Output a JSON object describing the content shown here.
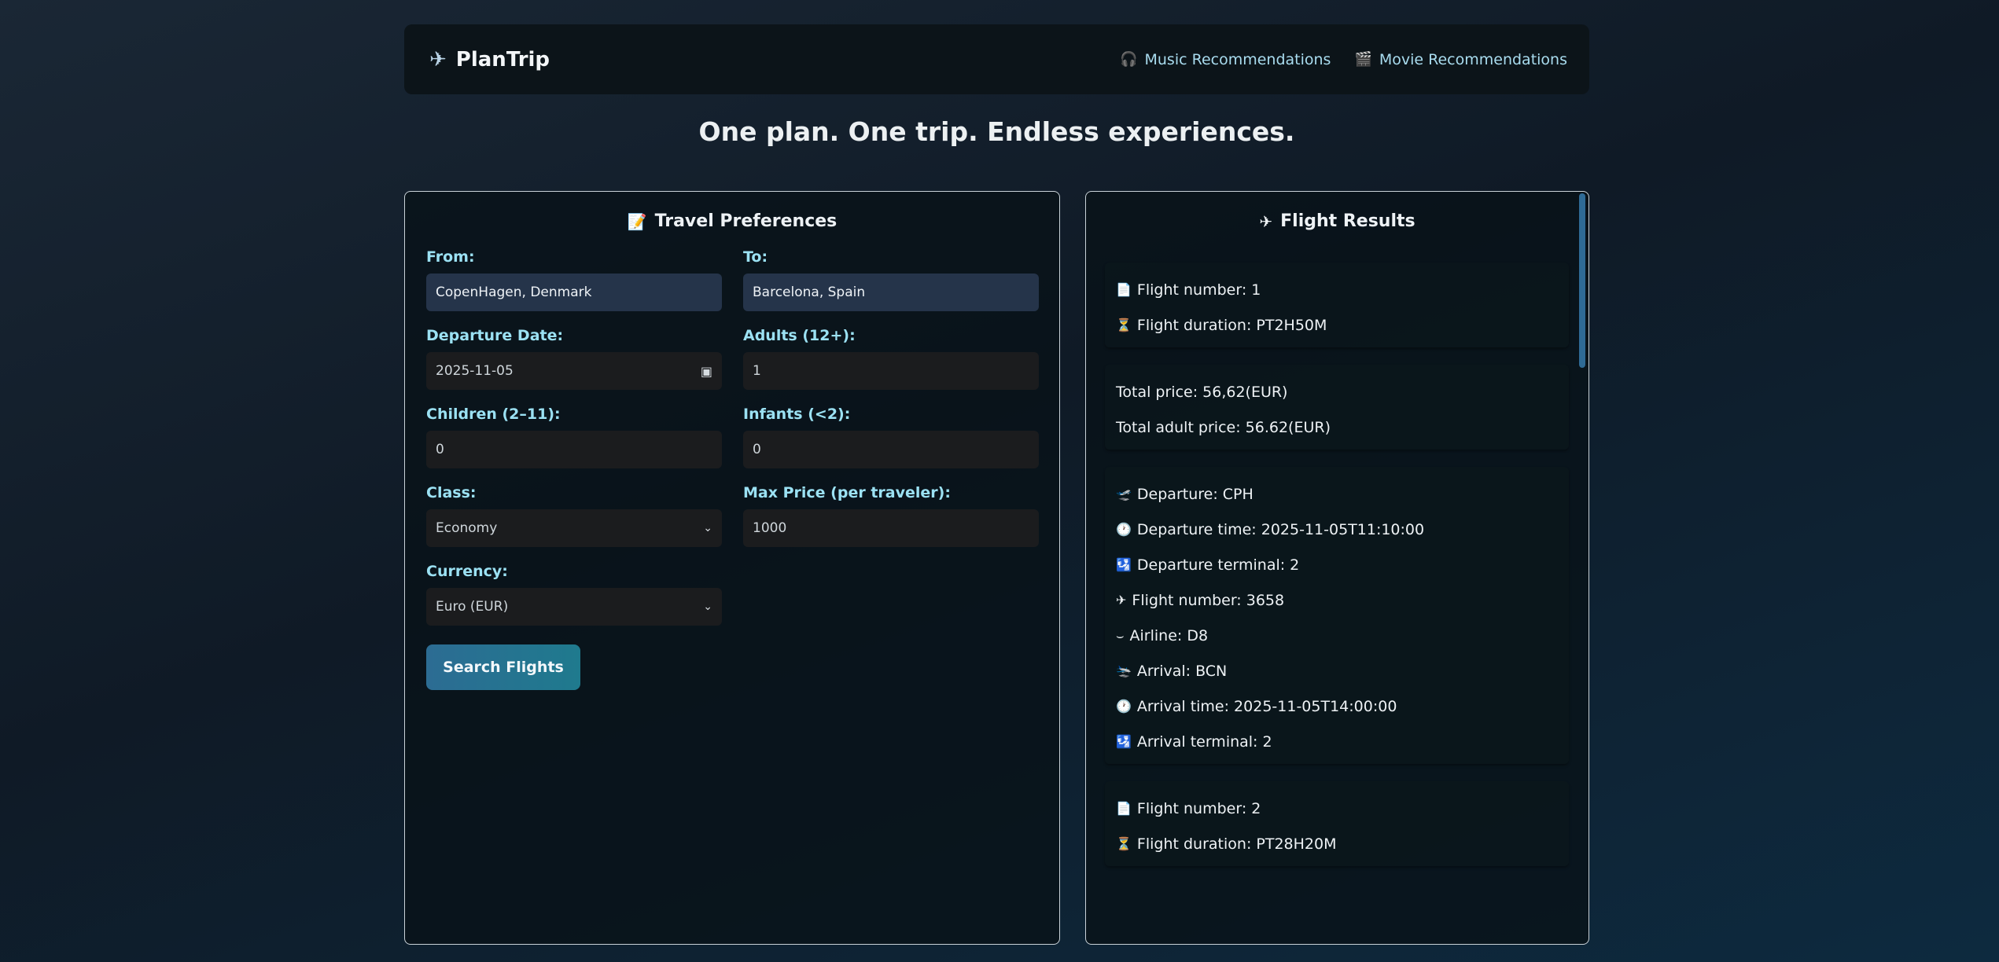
{
  "brand": {
    "name": "PlanTrip",
    "icon": "airplane-icon"
  },
  "nav": [
    {
      "label": "Music Recommendations",
      "icon": "headphones-icon"
    },
    {
      "label": "Movie Recommendations",
      "icon": "clapperboard-icon"
    }
  ],
  "tagline": "One plan. One trip. Endless experiences.",
  "preferences": {
    "title": "Travel Preferences",
    "icon": "memo-icon",
    "from_label": "From:",
    "from_value": "CopenHagen, Denmark",
    "to_label": "To:",
    "to_value": "Barcelona, Spain",
    "departure_label": "Departure Date:",
    "departure_value": "2025-11-05",
    "adults_label": "Adults (12+):",
    "adults_value": "1",
    "children_label": "Children (2–11):",
    "children_value": "0",
    "infants_label": "Infants (<2):",
    "infants_value": "0",
    "class_label": "Class:",
    "class_value": "Economy",
    "maxprice_label": "Max Price (per traveler):",
    "maxprice_value": "1000",
    "currency_label": "Currency:",
    "currency_value": "Euro (EUR)",
    "search_button": "Search Flights"
  },
  "results": {
    "title": "Flight Results",
    "icon": "airplane-icon",
    "card1": {
      "flight_number": "Flight number: 1",
      "duration": "Flight duration: PT2H50M"
    },
    "card2": {
      "total_price": "Total price: 56,62(EUR)",
      "adult_price": "Total adult price: 56.62(EUR)"
    },
    "card3": {
      "departure": "Departure: CPH",
      "departure_time": "Departure time: 2025-11-05T11:10:00",
      "departure_terminal": "Departure terminal: 2",
      "flight_number": "Flight number: 3658",
      "airline": "Airline: D8",
      "arrival": "Arrival: BCN",
      "arrival_time": "Arrival time: 2025-11-05T14:00:00",
      "arrival_terminal": "Arrival terminal: 2"
    },
    "card4": {
      "flight_number": "Flight number: 2",
      "duration": "Flight duration: PT28H20M"
    }
  }
}
